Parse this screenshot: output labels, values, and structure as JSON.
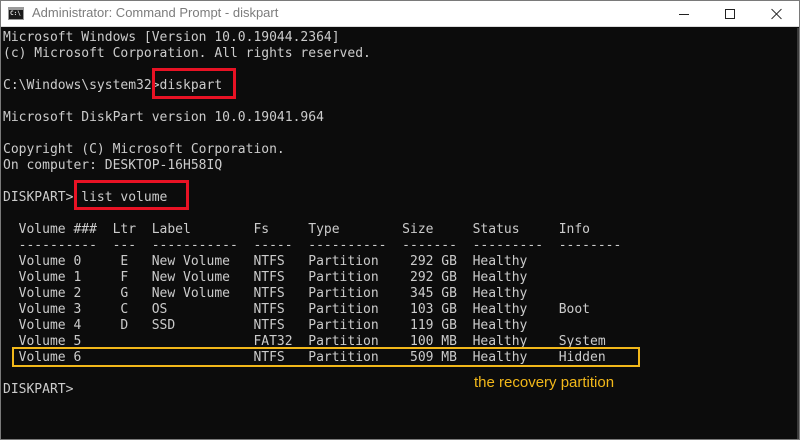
{
  "window": {
    "title": "Administrator: Command Prompt - diskpart",
    "app_icon_text": "C:\\"
  },
  "console": {
    "lines": [
      "Microsoft Windows [Version 10.0.19044.2364]",
      "(c) Microsoft Corporation. All rights reserved.",
      "",
      "C:\\Windows\\system32>diskpart",
      "",
      "Microsoft DiskPart version 10.0.19041.964",
      "",
      "Copyright (C) Microsoft Corporation.",
      "On computer: DESKTOP-16H58IQ",
      "",
      "DISKPART> list volume",
      "",
      "  Volume ###  Ltr  Label        Fs     Type        Size     Status     Info",
      "  ----------  ---  -----------  -----  ----------  -------  ---------  --------",
      "  Volume 0     E   New Volume   NTFS   Partition    292 GB  Healthy",
      "  Volume 1     F   New Volume   NTFS   Partition    292 GB  Healthy",
      "  Volume 2     G   New Volume   NTFS   Partition    345 GB  Healthy",
      "  Volume 3     C   OS           NTFS   Partition    103 GB  Healthy    Boot",
      "  Volume 4     D   SSD          NTFS   Partition    119 GB  Healthy",
      "  Volume 5                      FAT32  Partition    100 MB  Healthy    System",
      "  Volume 6                      NTFS   Partition    509 MB  Healthy    Hidden",
      "",
      "DISKPART>"
    ]
  },
  "annotation": {
    "text": "the recovery partition",
    "color": "#f2b81a"
  },
  "colors": {
    "console_bg": "#0c0c0c",
    "console_text": "#cccccc",
    "highlight_red": "#e81224",
    "highlight_yellow": "#f2b81a"
  }
}
